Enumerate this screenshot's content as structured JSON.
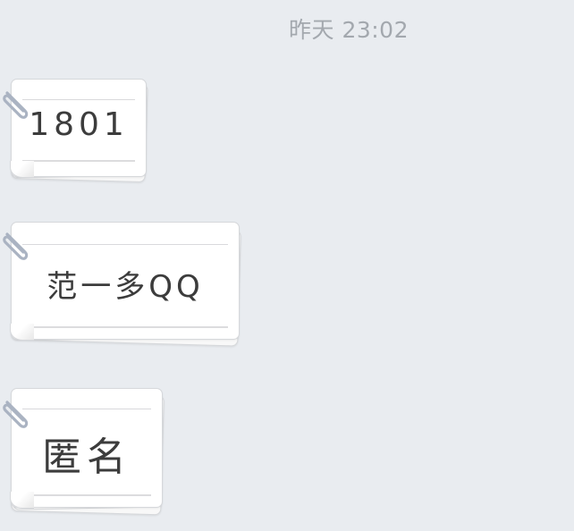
{
  "chat": {
    "timestamp": "昨天 23:02",
    "messages": [
      {
        "text": "1801"
      },
      {
        "text": "范一多QQ"
      },
      {
        "text": "匿名"
      }
    ]
  },
  "colors": {
    "background": "#e9ecf0",
    "note": "#ffffff",
    "timestamp_text": "#a3a8ae",
    "note_text": "#3c3c3c",
    "clip": "#aab3c2"
  },
  "icons": {
    "clip": "paperclip-icon"
  }
}
